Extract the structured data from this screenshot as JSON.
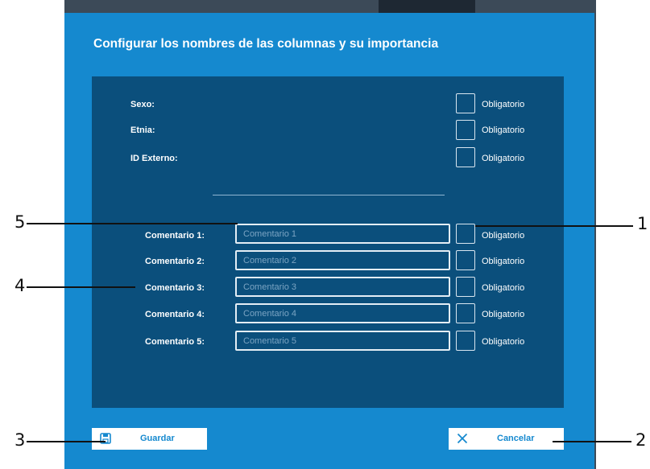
{
  "dialog": {
    "title": "Configurar los nombres de las columnas y su importancia"
  },
  "fixed_fields": [
    {
      "label": "Sexo:",
      "checkbox_label": "Obligatorio",
      "checked": false
    },
    {
      "label": "Etnia:",
      "checkbox_label": "Obligatorio",
      "checked": false
    },
    {
      "label": "ID Externo:",
      "checkbox_label": "Obligatorio",
      "checked": false
    }
  ],
  "comment_fields": [
    {
      "label": "Comentario 1:",
      "placeholder": "Comentario 1",
      "value": "",
      "checkbox_label": "Obligatorio",
      "checked": false
    },
    {
      "label": "Comentario 2:",
      "placeholder": "Comentario 2",
      "value": "",
      "checkbox_label": "Obligatorio",
      "checked": false
    },
    {
      "label": "Comentario 3:",
      "placeholder": "Comentario 3",
      "value": "",
      "checkbox_label": "Obligatorio",
      "checked": false
    },
    {
      "label": "Comentario 4:",
      "placeholder": "Comentario 4",
      "value": "",
      "checkbox_label": "Obligatorio",
      "checked": false
    },
    {
      "label": "Comentario 5:",
      "placeholder": "Comentario 5",
      "value": "",
      "checkbox_label": "Obligatorio",
      "checked": false
    }
  ],
  "buttons": {
    "save": {
      "label": "Guardar",
      "icon": "floppy-disk-icon"
    },
    "cancel": {
      "label": "Cancelar",
      "icon": "close-icon"
    }
  },
  "callouts": [
    "1",
    "2",
    "3",
    "4",
    "5"
  ],
  "colors": {
    "dialog_bg": "#1589cf",
    "panel_bg": "#0b4f7c",
    "button_text": "#1589cf"
  }
}
